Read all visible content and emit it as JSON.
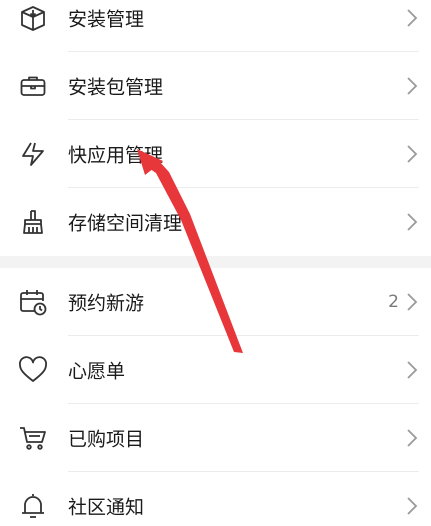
{
  "group1": {
    "items": [
      {
        "label": "安装管理",
        "icon": "install-box-icon"
      },
      {
        "label": "安装包管理",
        "icon": "briefcase-icon"
      },
      {
        "label": "快应用管理",
        "icon": "lightning-icon"
      },
      {
        "label": "存储空间清理",
        "icon": "broom-icon"
      }
    ]
  },
  "group2": {
    "items": [
      {
        "label": "预约新游",
        "icon": "calendar-clock-icon",
        "badge": "2"
      },
      {
        "label": "心愿单",
        "icon": "heart-icon"
      },
      {
        "label": "已购项目",
        "icon": "cart-icon"
      },
      {
        "label": "社区通知",
        "icon": "bell-icon"
      }
    ]
  },
  "colors": {
    "annotation_arrow": "#e8373a",
    "icon_stroke": "#333333",
    "chevron": "#9a9a9a"
  }
}
